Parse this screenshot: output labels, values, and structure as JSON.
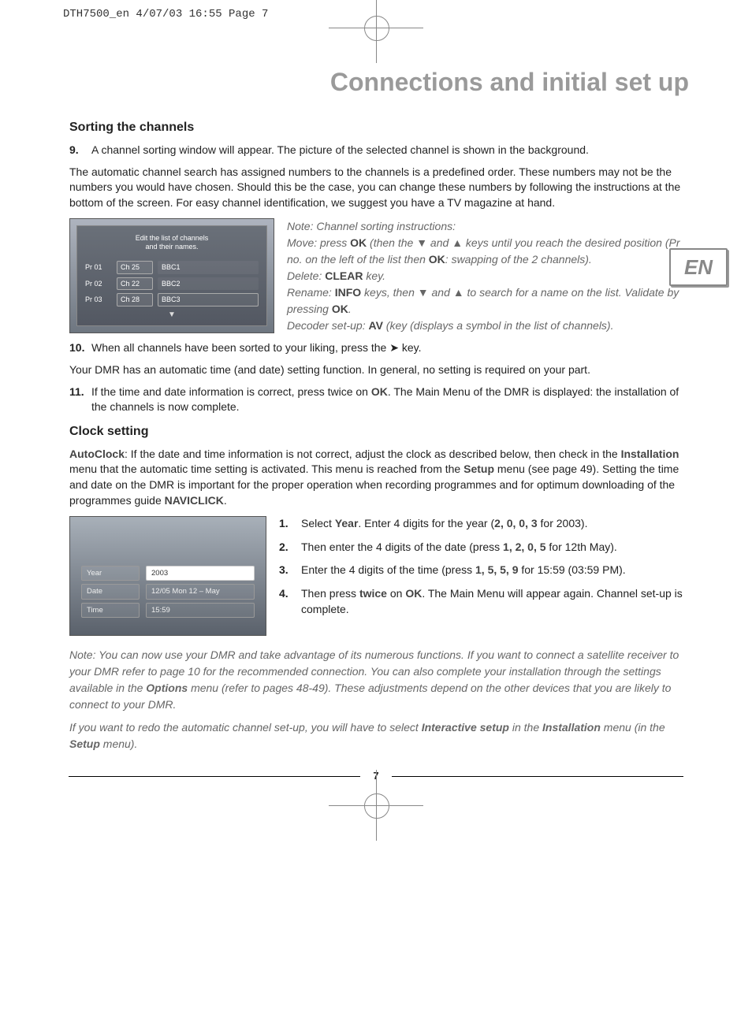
{
  "print_info": "DTH7500_en  4/07/03  16:55  Page 7",
  "main_title": "Connections and initial set up",
  "lang_tab": "EN",
  "page_number": "7",
  "sorting": {
    "heading": "Sorting the channels",
    "step9_num": "9.",
    "step9_text": "A channel sorting window will appear. The picture of the selected channel is shown in the background.",
    "para1": "The automatic channel search has assigned numbers to the channels is a predefined order. These numbers may not be the numbers you would have chosen. Should this be the case, you can change these numbers by following the instructions at the bottom of the screen. For easy channel identification, we suggest you have a TV magazine at hand.",
    "shot_caption": "Edit the list of channels\nand their names.",
    "rows": [
      {
        "pr": "Pr 01",
        "ch": "Ch 25",
        "name": "BBC1"
      },
      {
        "pr": "Pr 02",
        "ch": "Ch 22",
        "name": "BBC2"
      },
      {
        "pr": "Pr 03",
        "ch": "Ch 28",
        "name": "BBC3"
      }
    ],
    "note_title": "Note: Channel sorting instructions:",
    "note_move_pre": "Move: press ",
    "note_move_ok": "OK",
    "note_move_mid": " (then the ",
    "note_move_suf": " keys until you reach the desired position (Pr no. on the left of the list then ",
    "note_move_ok2": "OK",
    "note_move_end": ": swapping of the 2 channels).",
    "note_delete_pre": "Delete: ",
    "note_delete_key": "CLEAR",
    "note_delete_suf": " key.",
    "note_rename_pre": "Rename: ",
    "note_rename_key": "INFO",
    "note_rename_mid": " keys, then ",
    "note_rename_suf": " to search for a name on the list. Validate by pressing ",
    "note_rename_ok": "OK",
    "note_rename_end": ".",
    "note_decoder_pre": "Decoder set-up: ",
    "note_decoder_key": "AV",
    "note_decoder_suf": " (key (displays a symbol in the list of channels).",
    "step10_num": "10.",
    "step10_pre": "When all channels have been sorted to your liking, press the ",
    "step10_suf": " key.",
    "para2": "Your DMR has an automatic time (and date) setting function. In general, no setting is required on your part.",
    "step11_num": "11.",
    "step11_pre": "If the time and date information is correct, press twice on ",
    "step11_ok": "OK",
    "step11_suf": ". The Main Menu of the DMR is displayed: the installation of the channels is now complete."
  },
  "clock": {
    "heading": "Clock setting",
    "para_pre1": "AutoClock",
    "para_mid1": ": If the date and time information is not correct, adjust the clock as described below, then check in the ",
    "para_b2": "Installation",
    "para_mid2": " menu that the automatic time setting is activated. This menu is reached from the ",
    "para_b3": "Setup",
    "para_mid3": " menu (see page 49). Setting the time and date on the DMR is important for the proper operation when recording programmes and for optimum downloading of the programmes guide ",
    "para_b4": "NAVICLICK",
    "para_end": ".",
    "shot_rows": [
      {
        "label": "Year",
        "value": "2003",
        "selected": true
      },
      {
        "label": "Date",
        "value": "12/05  Mon 12 – May",
        "selected": false
      },
      {
        "label": "Time",
        "value": "15:59",
        "selected": false
      }
    ],
    "steps": {
      "s1_num": "1.",
      "s1_pre": "Select ",
      "s1_b1": "Year",
      "s1_mid": ". Enter 4 digits for the year (",
      "s1_digits": "2, 0, 0, 3",
      "s1_suf": " for 2003).",
      "s2_num": "2.",
      "s2_pre": "Then enter the 4 digits of the date (press ",
      "s2_digits": "1, 2, 0, 5",
      "s2_suf": " for 12th May).",
      "s3_num": "3.",
      "s3_pre": "Enter the 4 digits of the time (press ",
      "s3_digits": "1, 5, 5, 9",
      "s3_suf": " for 15:59 (03:59 PM).",
      "s4_num": "4.",
      "s4_pre": "Then press ",
      "s4_b1": "twice",
      "s4_mid": " on ",
      "s4_b2": "OK",
      "s4_suf": ". The Main Menu will appear again. Channel set-up is complete."
    },
    "note2_pre": "Note: You can now use your DMR and take advantage of its numerous functions. If you want to connect a satellite receiver to your DMR refer to page 10 for the recommended connection. You can also complete your installation through the settings available in the ",
    "note2_b1": "Options",
    "note2_mid": " menu (refer to pages 48-49). These adjustments depend on the other devices that you are likely to connect to your DMR.",
    "note3_pre": "If you want to redo the automatic channel set-up, you will have to select ",
    "note3_b1": "Interactive setup",
    "note3_mid": " in the ",
    "note3_b2": "Installation",
    "note3_mid2": " menu (in the ",
    "note3_b3": "Setup",
    "note3_suf": " menu)."
  }
}
